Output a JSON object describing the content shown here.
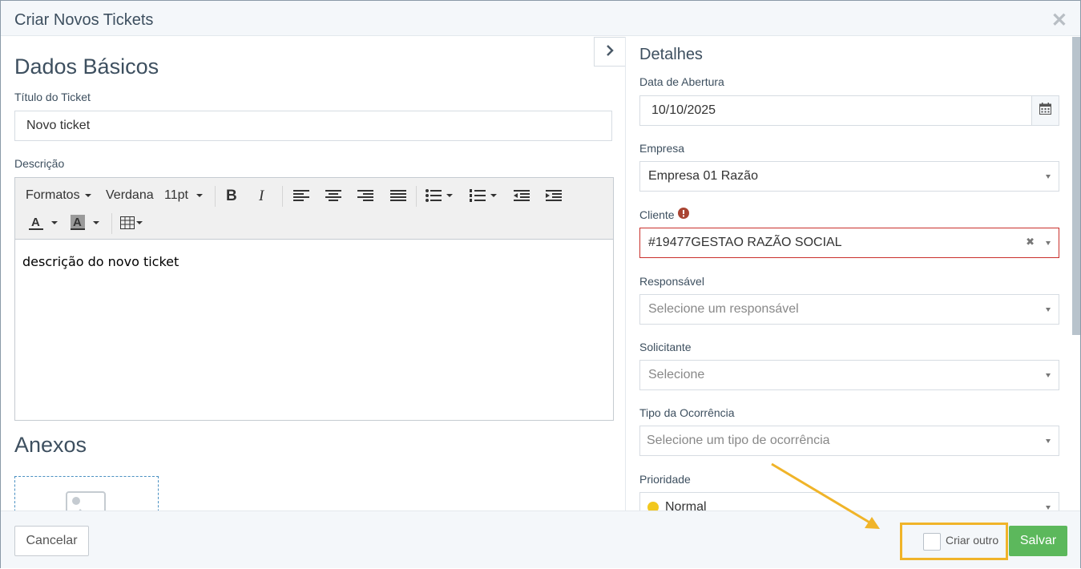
{
  "modal": {
    "title": "Criar Novos Tickets"
  },
  "left": {
    "section_title": "Dados Básicos",
    "ticket_title_label": "Título do Ticket",
    "ticket_title_value": "Novo ticket",
    "description_label": "Descrição",
    "toolbar": {
      "formats": "Formatos",
      "font": "Verdana",
      "size": "11pt"
    },
    "description_text": "descrição do novo ticket",
    "attachments_title": "Anexos"
  },
  "right": {
    "section_title": "Detalhes",
    "open_date_label": "Data de Abertura",
    "open_date_value": "10/10/2025",
    "company_label": "Empresa",
    "company_value": "Empresa 01 Razão",
    "client_label": "Cliente",
    "client_value": "#19477GESTAO RAZÃO SOCIAL",
    "responsible_label": "Responsável",
    "responsible_placeholder": "Selecione um responsável",
    "requester_label": "Solicitante",
    "requester_placeholder": "Selecione",
    "occurrence_label": "Tipo da Ocorrência",
    "occurrence_placeholder": "Selecione um tipo de ocorrência",
    "priority_label": "Prioridade",
    "priority_value": "Normal"
  },
  "footer": {
    "cancel_label": "Cancelar",
    "create_another_label": "Criar outro",
    "save_label": "Salvar"
  },
  "colors": {
    "accent": "#5cb85c",
    "error": "#c9302c",
    "highlight": "#f0b429",
    "priority_normal": "#f2c81e"
  }
}
